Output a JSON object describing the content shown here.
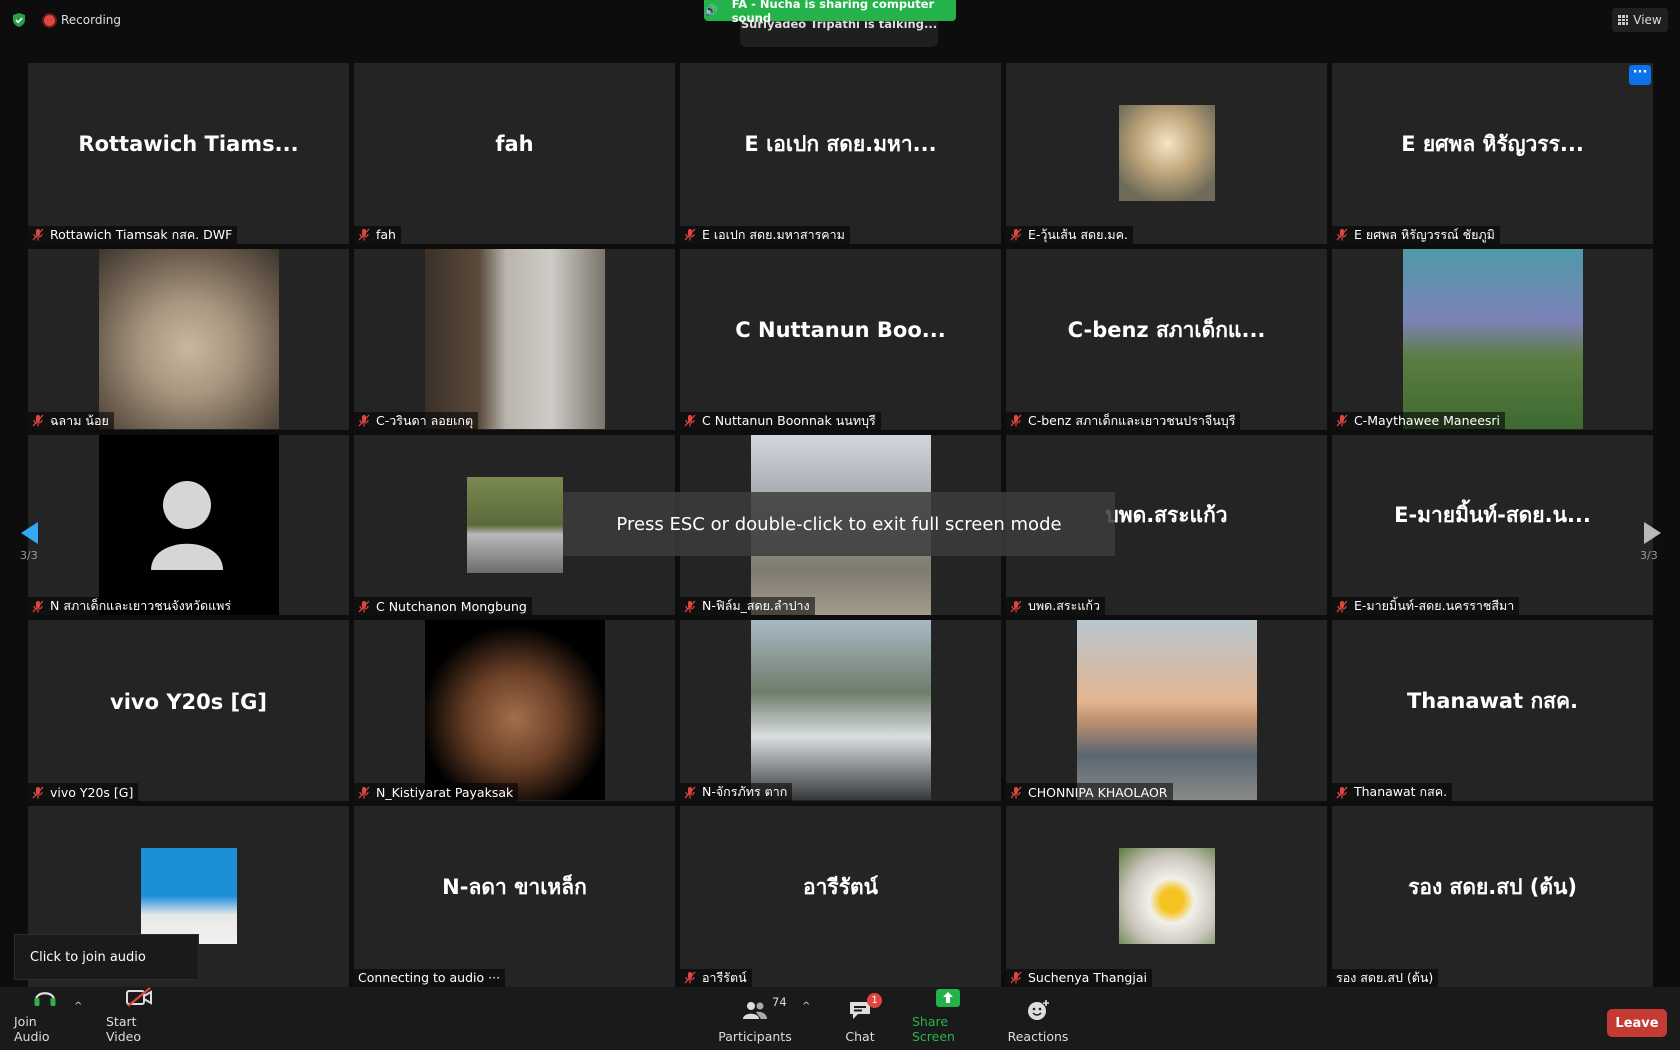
{
  "top": {
    "recording_label": "Recording",
    "share_banner": "FA - Nucha is sharing computer sound",
    "talking": "Suriyadeo Tripathi is talking...",
    "view_label": "View"
  },
  "tiles": [
    {
      "big": "Rottawich  Tiams...",
      "name": "Rottawich Tiamsak กสค. DWF",
      "muted": true
    },
    {
      "big": "fah",
      "name": "fah",
      "muted": true
    },
    {
      "big": "E เอเปก  สดย.มหา...",
      "name": "E เอเปก  สดย.มหาสารคาม",
      "muted": true
    },
    {
      "big": "",
      "name": "E-วุ้นเส้น สดย.มค.",
      "muted": true,
      "pic": "sunny",
      "pic_size": "small"
    },
    {
      "big": "E ยศพล หิรัญวรร...",
      "name": "E ยศพล หิรัญวรรณ์ ชัยภูมิ",
      "muted": true
    },
    {
      "big": "",
      "name": "ฉลาม น้อย",
      "muted": true,
      "pic": "cat",
      "pic_size": "full"
    },
    {
      "big": "",
      "name": "C-วรินดา ลอยเกตุ",
      "muted": true,
      "pic": "cafe",
      "pic_size": "full"
    },
    {
      "big": "C   Nuttanun Boo...",
      "name": "C  Nuttanun Boonnak นนทบุรี",
      "muted": true
    },
    {
      "big": "C-benz สภาเด็กแ...",
      "name": "C-benz สภาเด็กและเยาวชนปราจีนบุรี",
      "muted": true
    },
    {
      "big": "",
      "name": "C-Maythawee Maneesri",
      "muted": true,
      "pic": "grass",
      "pic_size": "full"
    },
    {
      "big": "",
      "name": "N สภาเด็กและเยาวชนจังหวัดแพร่",
      "muted": true,
      "pic": "black",
      "pic_size": "full"
    },
    {
      "big": "",
      "name": "C Nutchanon Mongbung",
      "muted": true,
      "pic": "forest",
      "pic_size": "small"
    },
    {
      "big": "",
      "name": "N-ฟิล์ม_สดย.ลำปาง",
      "muted": true,
      "pic": "street",
      "pic_size": "full"
    },
    {
      "big": "บพด.สระแก้ว",
      "name": "บพด.สระแก้ว",
      "muted": true
    },
    {
      "big": "E-มายมิ้นท์-สดย.น...",
      "name": "E-มายมิ้นท์-สดย.นครราชสีมา",
      "muted": true
    },
    {
      "big": "vivo Y20s [G]",
      "name": "vivo Y20s [G]",
      "muted": true
    },
    {
      "big": "",
      "name": "N_Kistiyarat Payaksak",
      "muted": true,
      "pic": "nightface",
      "pic_size": "full"
    },
    {
      "big": "",
      "name": "N-จักรภัทร ตาก",
      "muted": true,
      "pic": "school",
      "pic_size": "full"
    },
    {
      "big": "",
      "name": "CHONNIPA KHAOLAOR",
      "muted": true,
      "pic": "sunset",
      "pic_size": "full"
    },
    {
      "big": "Thanawat กสค.",
      "name": "Thanawat กสค.",
      "muted": true
    },
    {
      "big": "",
      "name": "",
      "muted": true,
      "pic": "blueid",
      "pic_size": "small"
    },
    {
      "big": "N-ลดา ขาเหล็ก",
      "name": "Connecting to audio ···",
      "muted": false
    },
    {
      "big": "อารีรัตน์",
      "name": "อารีรัตน์",
      "muted": true
    },
    {
      "big": "",
      "name": "Suchenya Thangjai",
      "muted": true,
      "pic": "dog",
      "pic_size": "small"
    },
    {
      "big": "รอง สดย.สป (ต้น)",
      "name": "รอง สดย.สป (ต้น)",
      "muted": false
    }
  ],
  "page": {
    "left": "3/3",
    "right": "3/3"
  },
  "toast": "Press ESC or double-click to exit full screen mode",
  "tooltip": "Click to join audio",
  "toolbar": {
    "join_audio": "Join Audio",
    "start_video": "Start Video",
    "participants": "Participants",
    "participants_count": "74",
    "chat": "Chat",
    "chat_badge": "1",
    "share_screen": "Share Screen",
    "reactions": "Reactions",
    "leave": "Leave"
  },
  "colors": {
    "accent_green": "#24b24a",
    "leave_red": "#c53a33",
    "mute_red": "#e0463f",
    "blue": "#0e72ed"
  }
}
